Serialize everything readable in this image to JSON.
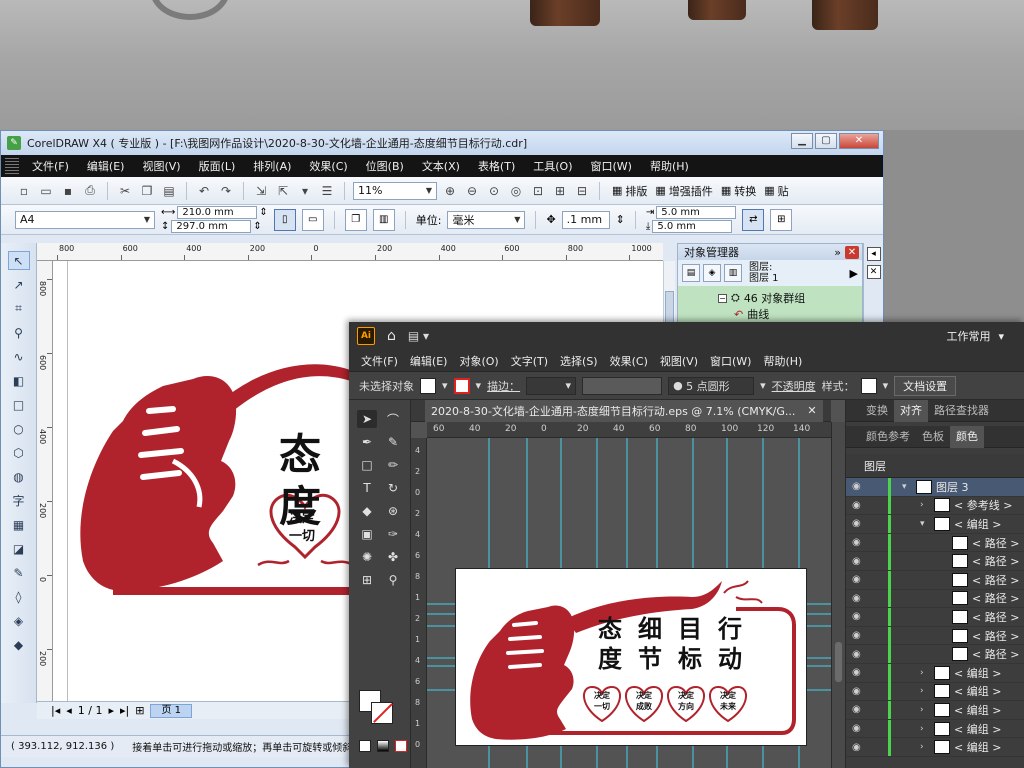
{
  "corel": {
    "title": "CorelDRAW X4 ( 专业版 ) - [F:\\我图网作品设计\\2020-8-30-文化墙-企业通用-态度细节目标行动.cdr]",
    "menu": [
      "文件(F)",
      "编辑(E)",
      "视图(V)",
      "版面(L)",
      "排列(A)",
      "效果(C)",
      "位图(B)",
      "文本(X)",
      "表格(T)",
      "工具(O)",
      "窗口(W)",
      "帮助(H)"
    ],
    "zoom": "11%",
    "toolbar_extra": [
      "排版",
      "增强插件",
      "转换",
      "贴"
    ],
    "page_size": "A4",
    "width": "210.0 mm",
    "height": "297.0 mm",
    "unit_label": "单位:",
    "unit": "毫米",
    "nudge": ".1 mm",
    "dup_x": "5.0 mm",
    "dup_y": "5.0 mm",
    "ruler_h": [
      "800",
      "600",
      "400",
      "200",
      "0",
      "200",
      "400",
      "600",
      "800",
      "1000"
    ],
    "ruler_v": [
      "800",
      "600",
      "400",
      "200",
      "0",
      "200"
    ],
    "obj_manager": {
      "title": "对象管理器",
      "layer_label_1": "图层:",
      "layer_label_2": "图层 1",
      "group": "46 对象群组",
      "curve": "曲线"
    },
    "page_nav": "1 / 1",
    "page_tab": "页 1",
    "status_coords": "( 393.112, 912.136 )",
    "status_msg": "接着单击可进行拖动或缩放；再单击可旋转或倾斜",
    "art": {
      "word1": "态",
      "word2": "度",
      "heart_line1": "决定",
      "heart_line2": "一切"
    }
  },
  "ai": {
    "menu": [
      "文件(F)",
      "编辑(E)",
      "对象(O)",
      "文字(T)",
      "选择(S)",
      "效果(C)",
      "视图(V)",
      "窗口(W)",
      "帮助(H)"
    ],
    "workspace": "工作常用",
    "ctrl": {
      "no_selection": "未选择对象",
      "stroke_label": "描边：",
      "brush": "5 点圆形",
      "opacity": "不透明度",
      "style": "样式：",
      "doc_settings": "文档设置"
    },
    "doc_tab": "2020-8-30-文化墙-企业通用-态度细节目标行动.eps @ 7.1% (CMYK/G...",
    "ruler_h": [
      "60",
      "40",
      "20",
      "0",
      "20",
      "40",
      "60",
      "80",
      "100",
      "120",
      "140"
    ],
    "ruler_v": [
      "4",
      "2",
      "0",
      "2",
      "4",
      "6",
      "8",
      "1",
      "2",
      "1",
      "4",
      "6",
      "8",
      "1",
      "0"
    ],
    "panel_tabs_1": [
      "变换",
      "对齐",
      "路径查找器"
    ],
    "panel_tabs_2": [
      "颜色参考",
      "色板",
      "颜色"
    ],
    "layers_tab": "图层",
    "layers": [
      {
        "name": "图层 3",
        "level": 0
      },
      {
        "name": "< 参考线 >",
        "level": 1
      },
      {
        "name": "< 编组 >",
        "level": 1
      },
      {
        "name": "< 路径 >",
        "level": 2
      },
      {
        "name": "< 路径 >",
        "level": 2
      },
      {
        "name": "< 路径 >",
        "level": 2
      },
      {
        "name": "< 路径 >",
        "level": 2
      },
      {
        "name": "< 路径 >",
        "level": 2
      },
      {
        "name": "< 路径 >",
        "level": 2
      },
      {
        "name": "< 路径 >",
        "level": 2
      },
      {
        "name": "< 编组 >",
        "level": 1
      },
      {
        "name": "< 编组 >",
        "level": 1
      },
      {
        "name": "< 编组 >",
        "level": 1
      },
      {
        "name": "< 编组 >",
        "level": 1
      },
      {
        "name": "< 编组 >",
        "level": 1
      }
    ],
    "art": {
      "row1": [
        "态",
        "细",
        "目",
        "行"
      ],
      "row2": [
        "度",
        "节",
        "标",
        "动"
      ],
      "hearts": [
        [
          "决定",
          "一切"
        ],
        [
          "决定",
          "成败"
        ],
        [
          "决定",
          "方向"
        ],
        [
          "决定",
          "未来"
        ]
      ]
    }
  },
  "colors": {
    "brand_red": "#b0222c",
    "guide_cyan": "#3fd0e8"
  }
}
